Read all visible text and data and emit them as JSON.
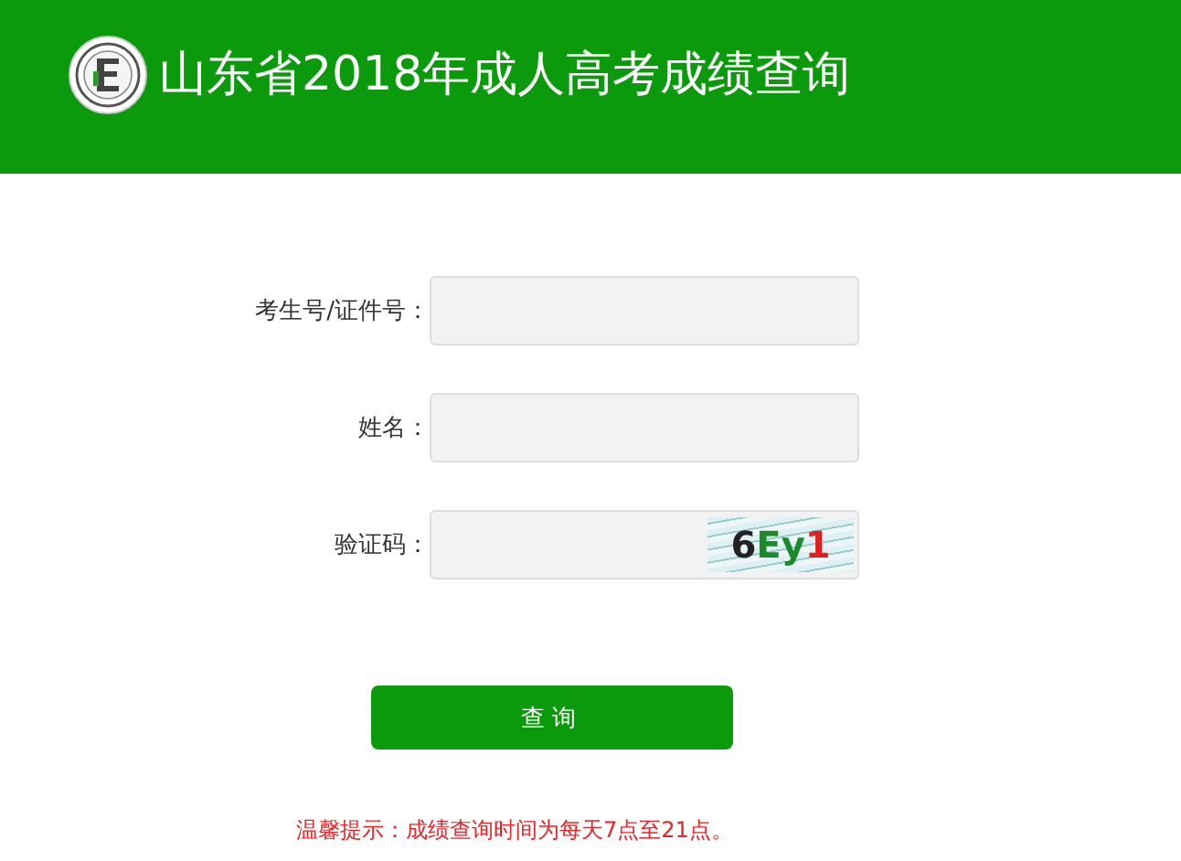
{
  "header": {
    "title": "山东省2018年成人高考成绩查询"
  },
  "fields": [
    {
      "label": "考生号/证件号：",
      "kind": "text"
    },
    {
      "label": "姓名：",
      "kind": "text"
    },
    {
      "label": "验证码：",
      "kind": "captcha",
      "captcha": "6Ey1"
    }
  ],
  "submit_button": "查询",
  "notice": "温馨提示：成绩查询时间为每天7点至21点。"
}
